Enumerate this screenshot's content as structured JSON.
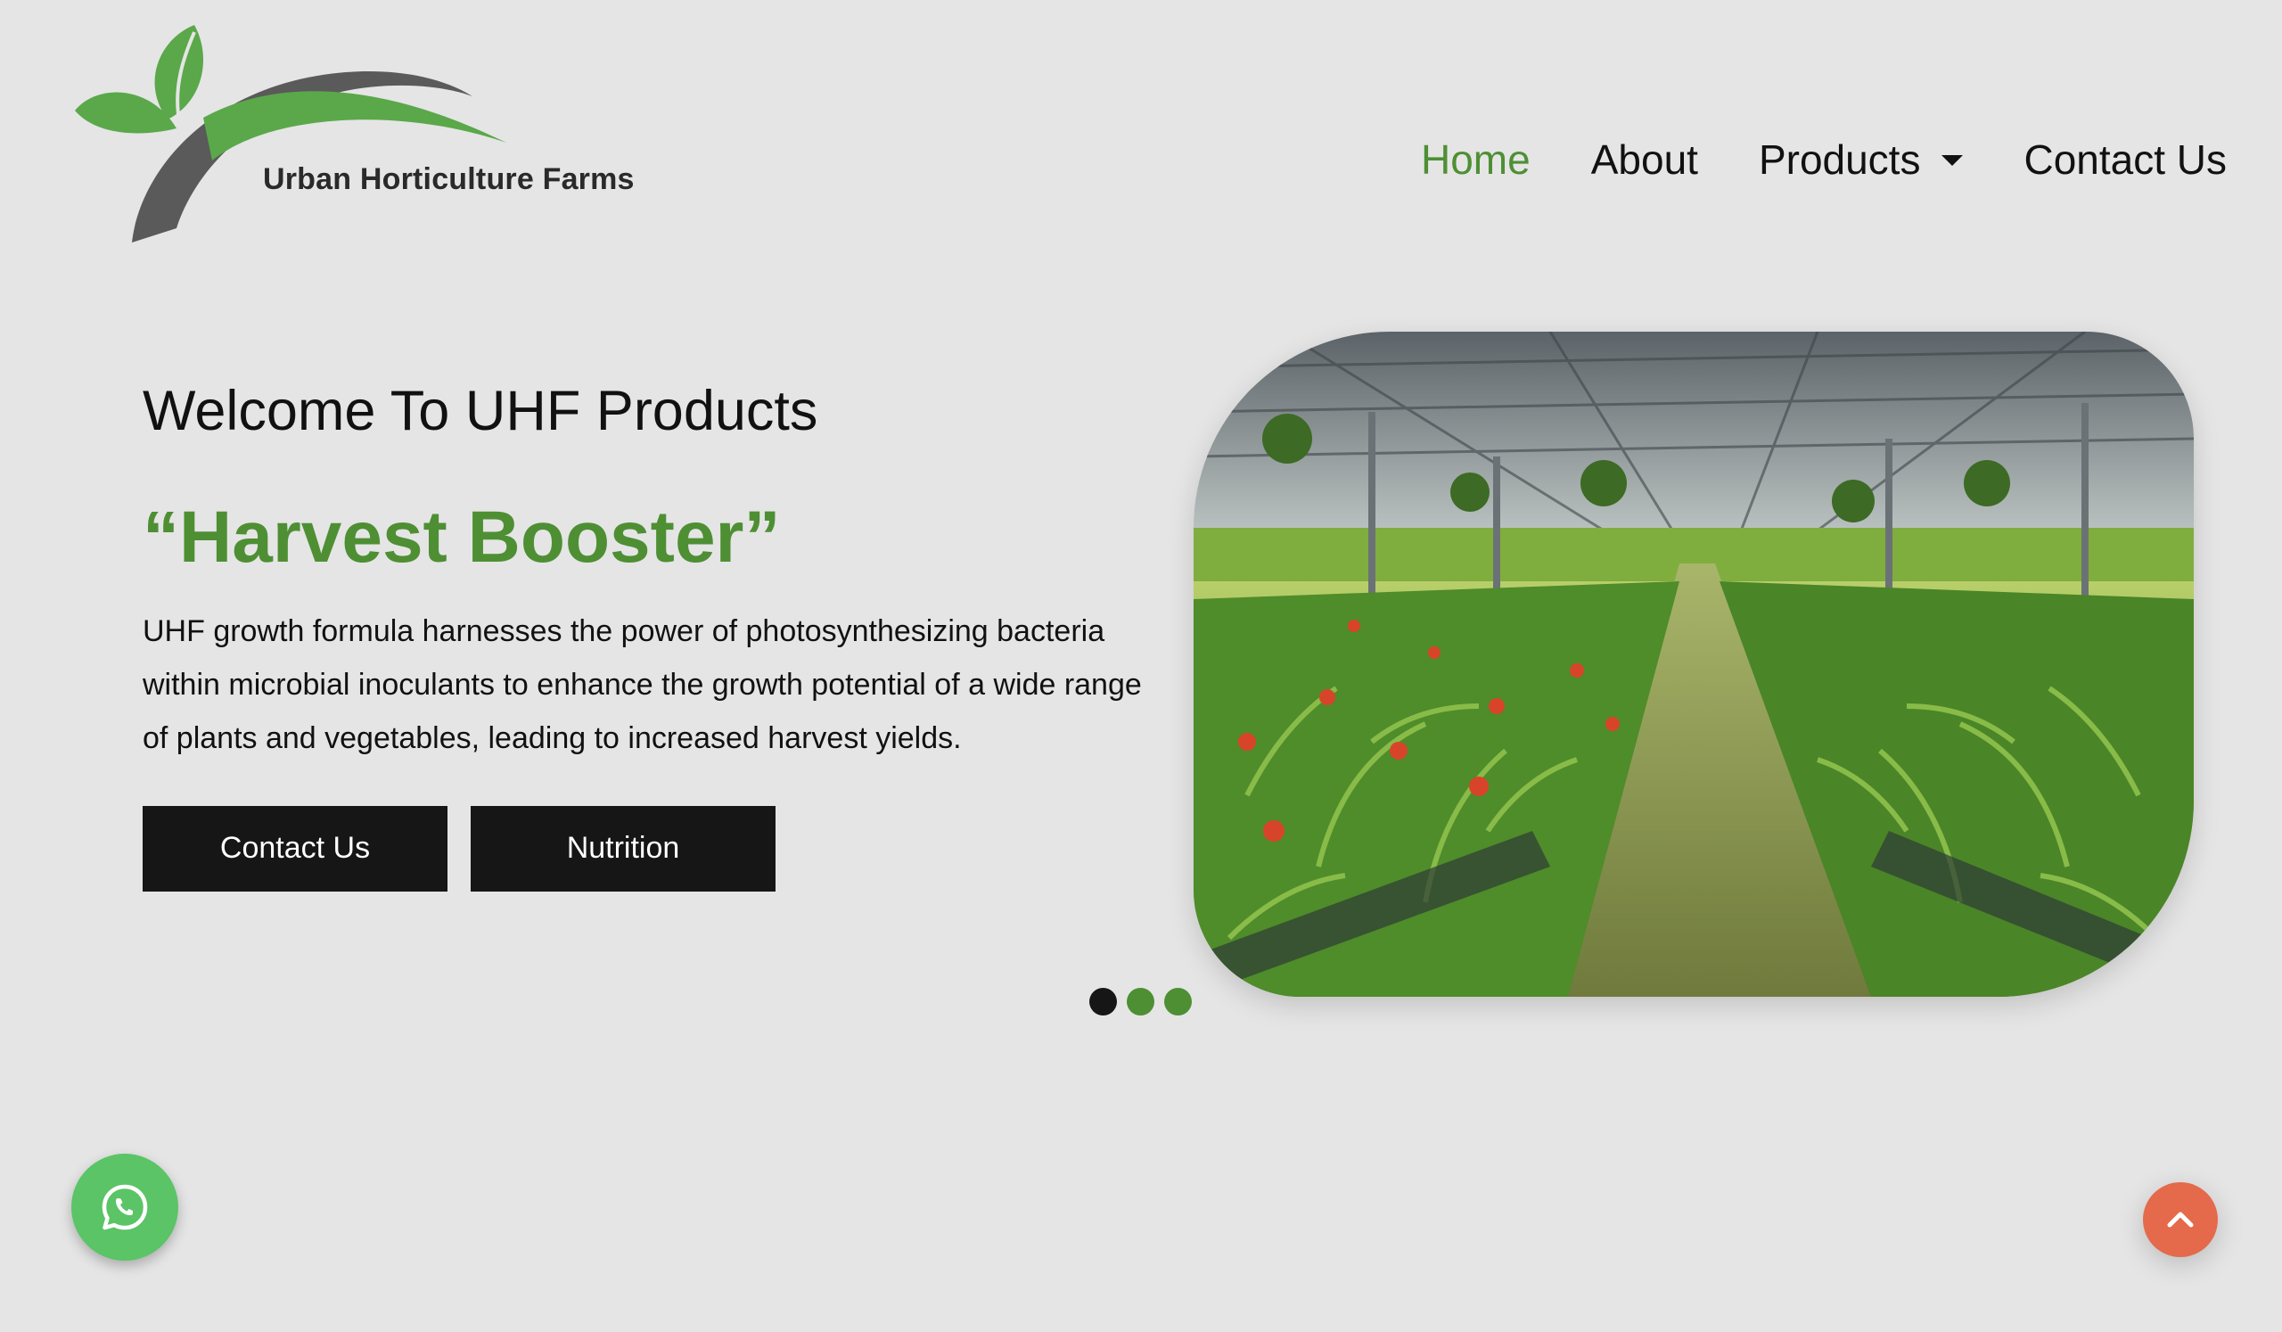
{
  "header": {
    "brand_name": "Urban Horticulture Farms",
    "nav": {
      "home": "Home",
      "about": "About",
      "products": "Products",
      "contact": "Contact Us"
    }
  },
  "hero": {
    "welcome": "Welcome To UHF Products",
    "tagline": "“Harvest Booster”",
    "description": "UHF growth formula harnesses the power of photosynthesizing bacteria within microbial inoculants to enhance the growth potential of a wide range of plants and vegetables, leading to increased harvest yields.",
    "buttons": {
      "contact": "Contact Us",
      "nutrition": "Nutrition"
    },
    "carousel": {
      "slide_count": 3,
      "active_index": 0
    }
  },
  "icons": {
    "logo": "leaf-swoosh-logo",
    "whatsapp": "whatsapp-icon",
    "scroll_top": "chevron-up-icon"
  },
  "colors": {
    "accent_green": "#4e8f34",
    "background": "#e5e5e5",
    "button_dark": "#161616",
    "whatsapp_green": "#5bc466",
    "scroll_top_orange": "#e46a4b"
  }
}
